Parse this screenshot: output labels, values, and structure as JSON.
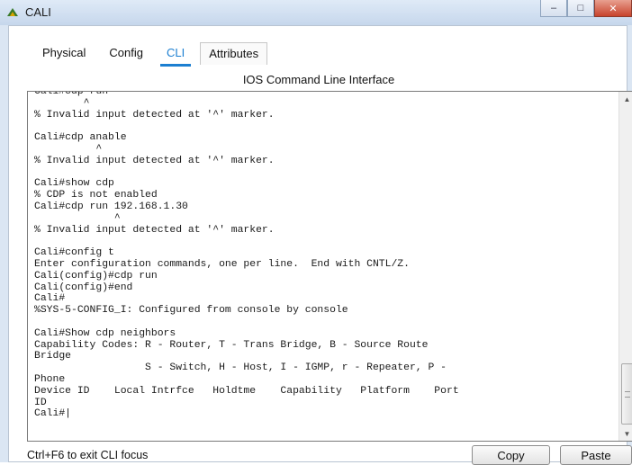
{
  "window": {
    "title": "CALI",
    "controls": {
      "minimize": "–",
      "maximize": "□",
      "close": "✕"
    }
  },
  "tabs": [
    {
      "label": "Physical"
    },
    {
      "label": "Config"
    },
    {
      "label": "CLI",
      "active": true
    },
    {
      "label": "Attributes"
    }
  ],
  "panel_title": "IOS Command Line Interface",
  "console": {
    "lines": [
      "Cali#cdp run",
      "        ^",
      "% Invalid input detected at '^' marker.",
      "",
      "Cali#cdp anable",
      "          ^",
      "% Invalid input detected at '^' marker.",
      "",
      "Cali#show cdp",
      "% CDP is not enabled",
      "Cali#cdp run 192.168.1.30",
      "             ^",
      "% Invalid input detected at '^' marker.",
      "",
      "Cali#config t",
      "Enter configuration commands, one per line.  End with CNTL/Z.",
      "Cali(config)#cdp run",
      "Cali(config)#end",
      "Cali#",
      "%SYS-5-CONFIG_I: Configured from console by console",
      "",
      "Cali#Show cdp neighbors",
      "Capability Codes: R - Router, T - Trans Bridge, B - Source Route",
      "Bridge",
      "                  S - Switch, H - Host, I - IGMP, r - Repeater, P -",
      "Phone",
      "Device ID    Local Intrfce   Holdtme    Capability   Platform    Port",
      "ID",
      "Cali#|"
    ]
  },
  "footer": {
    "hint": "Ctrl+F6 to exit CLI focus",
    "copy_label": "Copy",
    "paste_label": "Paste"
  },
  "icons": {
    "app": "packet-tracer-router-icon",
    "scroll_up": "arrow-up-icon",
    "scroll_down": "arrow-down-icon"
  },
  "colors": {
    "accent": "#1c7fd1"
  }
}
